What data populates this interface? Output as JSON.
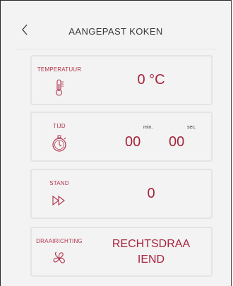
{
  "header": {
    "title": "AANGEPAST KOKEN"
  },
  "cards": {
    "temperature": {
      "label": "TEMPERATUUR",
      "value": "0 °C"
    },
    "time": {
      "label": "TIJD",
      "minutes": "00",
      "minutes_unit": "min.",
      "seconds": "00",
      "seconds_unit": "sec."
    },
    "mode": {
      "label": "STAND",
      "value": "0"
    },
    "direction": {
      "label": "DRAAIRICHTING",
      "value_line1": "RECHTSDRAA",
      "value_line2": "IEND"
    }
  },
  "colors": {
    "accent": "#a8233d",
    "label": "#b4334b",
    "background": "#f3f3f3",
    "card_border": "#e4e4e4"
  },
  "icons": {
    "temperature": "thermometer-icon",
    "time": "stopwatch-icon",
    "mode": "fast-forward-icon",
    "direction": "fan-icon"
  }
}
